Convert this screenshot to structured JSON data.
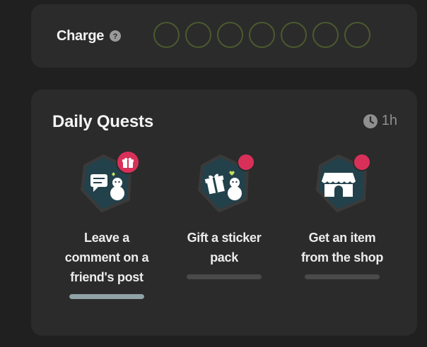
{
  "charge": {
    "label": "Charge",
    "slots_total": 7,
    "slots_filled": 0
  },
  "daily_quests": {
    "title": "Daily Quests",
    "timer": "1h",
    "quests": [
      {
        "label_lines": [
          "Leave a",
          "comment on a",
          "friend's post"
        ],
        "icon": "chat-snowman-icon",
        "badge": "gift-icon",
        "progress": 1.0
      },
      {
        "label_lines": [
          "Gift a sticker",
          "pack"
        ],
        "icon": "gift-snowman-icon",
        "badge": "notification-dot",
        "progress": 0
      },
      {
        "label_lines": [
          "Get an item",
          "from the shop"
        ],
        "icon": "shop-icon",
        "badge": "notification-dot",
        "progress": 0
      }
    ]
  },
  "colors": {
    "background": "#202020",
    "card": "#2b2b2b",
    "circle_border": "#4a5a2e",
    "badge": "#d9305a",
    "progress_track": "#4a4a4a",
    "progress_fill": "#8fa3a8",
    "icon_tile": "#23414b"
  }
}
